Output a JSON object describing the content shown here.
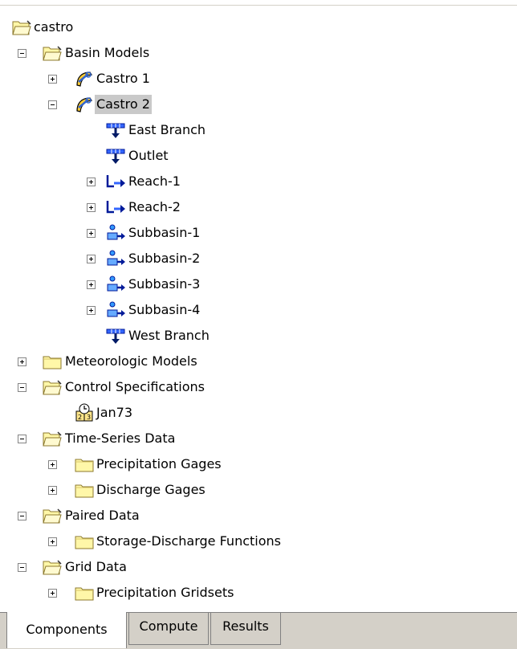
{
  "tree": {
    "root": "castro",
    "basin_models": "Basin Models",
    "castro1": "Castro 1",
    "castro2": "Castro 2",
    "east_branch": "East Branch",
    "outlet": "Outlet",
    "reach1": "Reach-1",
    "reach2": "Reach-2",
    "subbasin1": "Subbasin-1",
    "subbasin2": "Subbasin-2",
    "subbasin3": "Subbasin-3",
    "subbasin4": "Subbasin-4",
    "west_branch": "West Branch",
    "meteorologic_models": "Meteorologic Models",
    "control_specifications": "Control Specifications",
    "jan73": "Jan73",
    "time_series_data": "Time-Series Data",
    "precipitation_gages": "Precipitation Gages",
    "discharge_gages": "Discharge Gages",
    "paired_data": "Paired Data",
    "storage_discharge_functions": "Storage-Discharge Functions",
    "grid_data": "Grid Data",
    "precipitation_gridsets": "Precipitation Gridsets"
  },
  "tabs": {
    "components": "Components",
    "compute": "Compute",
    "results": "Results"
  },
  "icons": {
    "folder": "folder-icon",
    "open_folder": "open-folder-icon",
    "basin_model": "basin-model-icon",
    "junction": "junction-icon",
    "reach": "reach-icon",
    "subbasin": "subbasin-icon",
    "control_spec": "control-spec-icon"
  },
  "colors": {
    "folder_fill": "#fff7a8",
    "selection": "#c9c9c9",
    "element_blue": "#0033cc"
  }
}
